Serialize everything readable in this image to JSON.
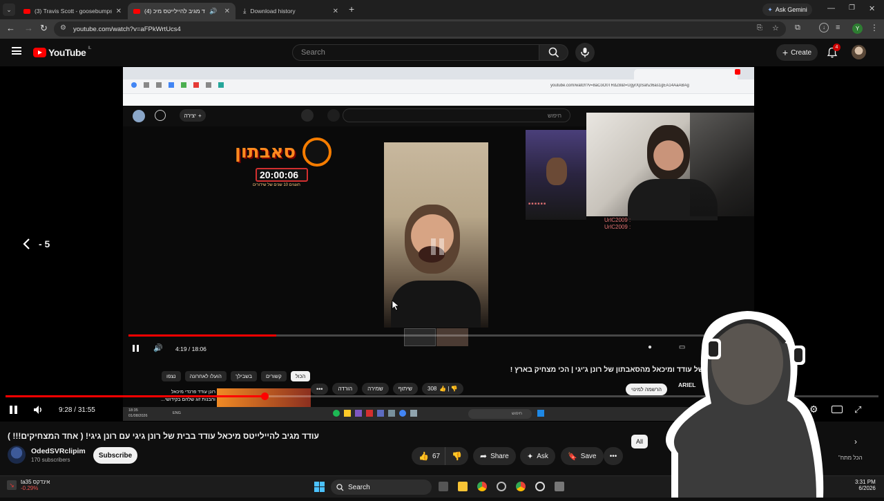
{
  "browser": {
    "tabs": [
      {
        "title": "(3) Travis Scott - goosebumps (",
        "active": false
      },
      {
        "title": "(4) עודד מגיב להיילייטס מיכ",
        "active": true
      },
      {
        "title": "Download history",
        "active": false
      }
    ],
    "ask_gemini": "Ask Gemini",
    "url": "youtube.com/watch?v=aFPkWrtUcs4",
    "profile_letter": "Y"
  },
  "youtube": {
    "logo_text": "YouTube",
    "logo_region": "IL",
    "search_placeholder": "Search",
    "create_label": "Create",
    "notification_count": "4"
  },
  "player": {
    "seek_back_label": "- 5",
    "current_time": "9:28",
    "duration": "31:55",
    "progress_fraction": 0.297,
    "inner_video": {
      "current_time": "4:19",
      "duration": "18:06",
      "progress_fraction": 0.238,
      "url_text": "youtube.com/watch?v=8aCoO0TRdZ8&t=UgyrXpSahZl6as1gEA14AaABAg",
      "search_placeholder": "חיפוש",
      "create_label": "יצירה",
      "stopwatch_brand": "סאבתון",
      "stopwatch_time": "20:00:06",
      "stopwatch_subtitle": "חוגגים 10 שנים של שידורים",
      "chat_lines": [
        "UrlC2009 :",
        "UrlC2009 :"
      ],
      "chips": [
        "הכול",
        "קשורים",
        "בשבילך",
        "הועלו לאחרונה",
        "נצפו"
      ],
      "title": "מצחיקים של עודד ומיכאל מהסאבתון של רונן ג'יגי | הכי מצחיק בארץ !",
      "subscribe_label": "הרשמה למינוי",
      "channel_name": "ARIEL",
      "like_count": "308",
      "actions": [
        "שיתוף",
        "שמירה",
        "הורדה"
      ],
      "side_video_title": "רונן עודד פרנדי מיכאל",
      "side_video_title2": "והבנות זוג שלהם בקידושי..."
    }
  },
  "video": {
    "title": "עודד מגיב להיילייטס מיכאל עודד בבית של רונן גיגי עם רונן גיגי! ( אחד המצחיקים!!! )",
    "channel_name": "OdedSVRclipim",
    "subscribers": "170 subscribers",
    "subscribe_label": "Subscribe",
    "likes": "67",
    "share_label": "Share",
    "ask_label": "Ask",
    "save_label": "Save",
    "filter_all": "All",
    "side_partial_title": "\"הכל מתח"
  },
  "taskbar": {
    "stock_name": "ta35 אינדקס",
    "stock_change": "-0.29%",
    "search_label": "Search",
    "time": "3:31 PM",
    "date": "6/2026",
    "inner_time": "18:35",
    "inner_date": "01/08/2026",
    "inner_lang": "ENG",
    "inner_search": "חיפוש"
  }
}
